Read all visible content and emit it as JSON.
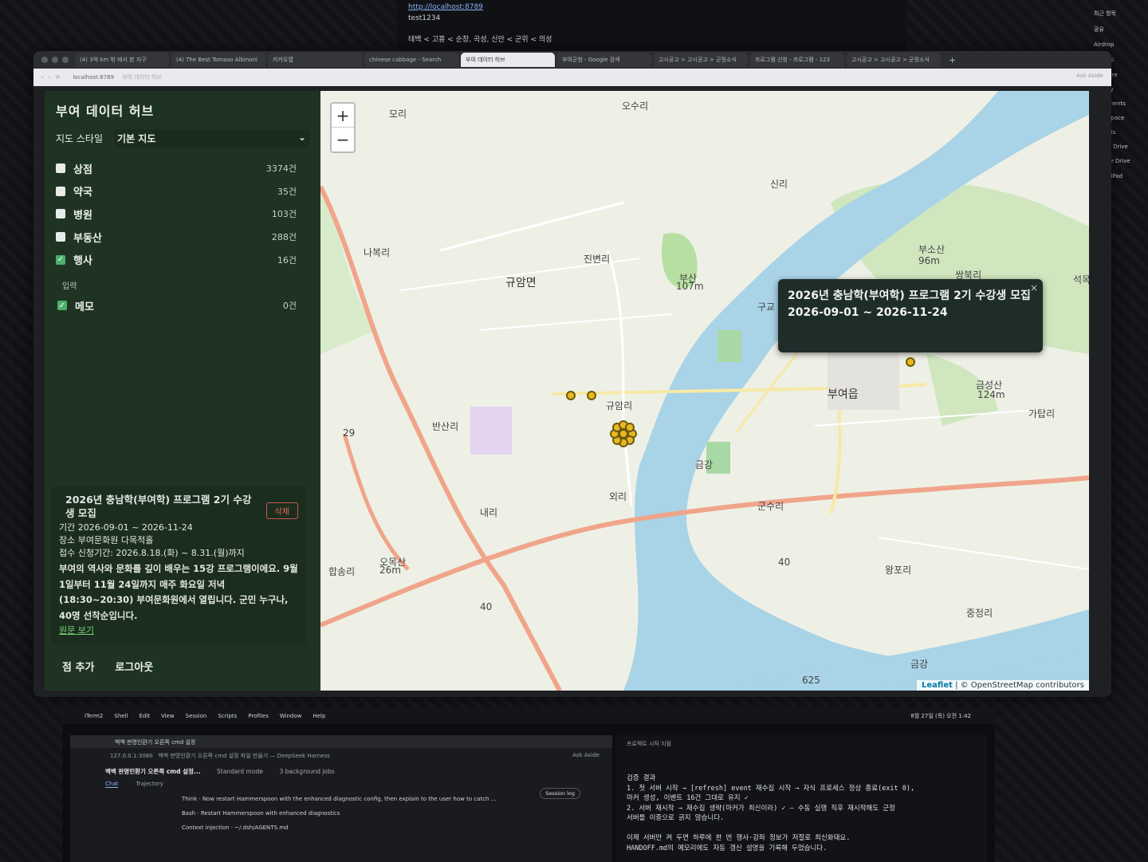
{
  "top_window": {
    "url": "http://localhost:8789",
    "text": "test1234",
    "breadcrumb": "테백 < 고흥 < 순창, 곡성, 신안 < 군위 < 의성"
  },
  "right_panel": [
    "최근 항목",
    "공유",
    "Airdrop",
    "다운로드",
    "AirShare",
    "Gallery",
    "Documents",
    "Workspace",
    "Projects",
    "iCloud Drive",
    "Google Drive",
    "재석의 iPad"
  ],
  "browser": {
    "tabs": [
      "(4) 3억 km 밖 에서 본 지구",
      "(4) The Best Tomaso Albinoni",
      "카카오맵",
      "chinese cabbage - Search",
      "부여 데이터 허브",
      "부여군청 - Google 검색",
      "고시공고 > 고시공고 > 군정소식",
      "프로그램 신청 - 프로그램 - 123",
      "고시공고 > 고시공고 > 군정소식"
    ],
    "active_tab": "부여 데이터 허브",
    "address": "localhost:8789",
    "address_title": "부여 데이터 허브",
    "ask_aside": "Ask Aside"
  },
  "sidebar": {
    "title": "부여 데이터 허브",
    "style_label": "지도 스타일",
    "style_value": "기본 지도",
    "layers": [
      {
        "label": "상점",
        "count": "3374건",
        "checked": false
      },
      {
        "label": "약국",
        "count": "35건",
        "checked": false
      },
      {
        "label": "병원",
        "count": "103건",
        "checked": false
      },
      {
        "label": "부동산",
        "count": "288건",
        "checked": false
      },
      {
        "label": "행사",
        "count": "16건",
        "checked": true
      }
    ],
    "input_section": "입력",
    "memo": {
      "label": "메모",
      "count": "0건",
      "checked": true
    },
    "card": {
      "title": "2026년 충남학(부여학) 프로그램 2기 수강생 모집",
      "delete": "삭제",
      "period": "기간 2026-09-01 ~ 2026-11-24",
      "place": "장소 부여문화원 다목적홀",
      "apply": "접수 신청기간: 2026.8.18.(화) ~ 8.31.(월)까지",
      "body": "부여의 역사와 문화를 깊이 배우는 15강 프로그램이에요. 9월 1일부터 11월 24일까지 매주 화요일 저녁(18:30~20:30) 부여문화원에서 열립니다. 군민 누구나, 40명 선착순입니다.",
      "link": "원문 보기"
    },
    "buttons": {
      "add_point": "점 추가",
      "logout": "로그아웃"
    }
  },
  "map": {
    "zoom_in": "+",
    "zoom_out": "−",
    "labels": [
      "모리",
      "오수리",
      "신리",
      "규암면",
      "진변리",
      "나복리",
      "부산",
      "107m",
      "구교",
      "부소산",
      "96m",
      "쌍북리",
      "석목",
      "규암리",
      "부여읍",
      "반산리",
      "금성산",
      "124m",
      "가탑리",
      "군수리",
      "외리",
      "내리",
      "합송리",
      "오목산",
      "26m",
      "왕포리",
      "중정리",
      "금강",
      "금강",
      "40",
      "40",
      "29",
      "625"
    ],
    "popup": {
      "title": "2026년 충남학(부여학) 프로그램 2기 수강생 모집",
      "dates": "2026-09-01 ~ 2026-11-24",
      "close": "×"
    },
    "attribution_leaflet": "Leaflet",
    "attribution_rest": "| © OpenStreetMap contributors",
    "colors": {
      "marker": "#e8b81e",
      "marker_stroke": "#6b5a10",
      "road_major": "#f0a58a",
      "road_minor": "#f7e9a6",
      "river": "#a9d3e6",
      "green": "#b7dfa2"
    }
  },
  "laptop": {
    "menu": [
      "iTerm2",
      "Shell",
      "Edit",
      "View",
      "Session",
      "Scripts",
      "Profiles",
      "Window",
      "Help"
    ],
    "clock": "8월 27일 (목) 오전 1:42",
    "left": {
      "tab": "백백 판명인환기 오른쪽 cmd 설정",
      "address": "127.0.0.1:3080",
      "address_title": "백백 판명인환기 오른쪽 cmd 설정 파일 만들기 — DeepSeek Harness",
      "ask_aside": "Ask Aside",
      "heading": "백백 판명인환기 오른쪽 cmd 설정...",
      "mode": "Standard mode",
      "jobs": "3 background jobs",
      "session_log": "Session log",
      "tabs": [
        "Chat",
        "Trajectory"
      ],
      "rows": [
        "Think · Now restart Hammerspoon with the enhanced diagnostic config, then explain to the user how to catch ...",
        "Bash · Restart Hammerspoon with enhanced diagnostics",
        "Context injection · ~/.dsh/AGENTS.md"
      ]
    },
    "right": {
      "window_title": "프로젝트 시작 지점",
      "lines": [
        "검증 결과",
        "1. 첫 서버 시작 → [refresh] event 재수집 시작 → 자식 프로세스 정상 종료(exit 0),",
        "   마커 생성, 이벤트 16건 그대로 유지 ✓",
        "2. 서버 재시작 → 재수집 생략(마커가 최신이라) ✓ — 수동 실행 직후 재시작해도 군정",
        "   서버를 이중으로 긁지 않습니다.",
        "",
        "이제 서버만 켜 두면 하루에 한 번 행사·강좌 정보가 저절로 최신화돼요.",
        "HANDOFF.md의 메모리에도 자동 갱신 설명을 기록해 두었습니다."
      ]
    }
  }
}
